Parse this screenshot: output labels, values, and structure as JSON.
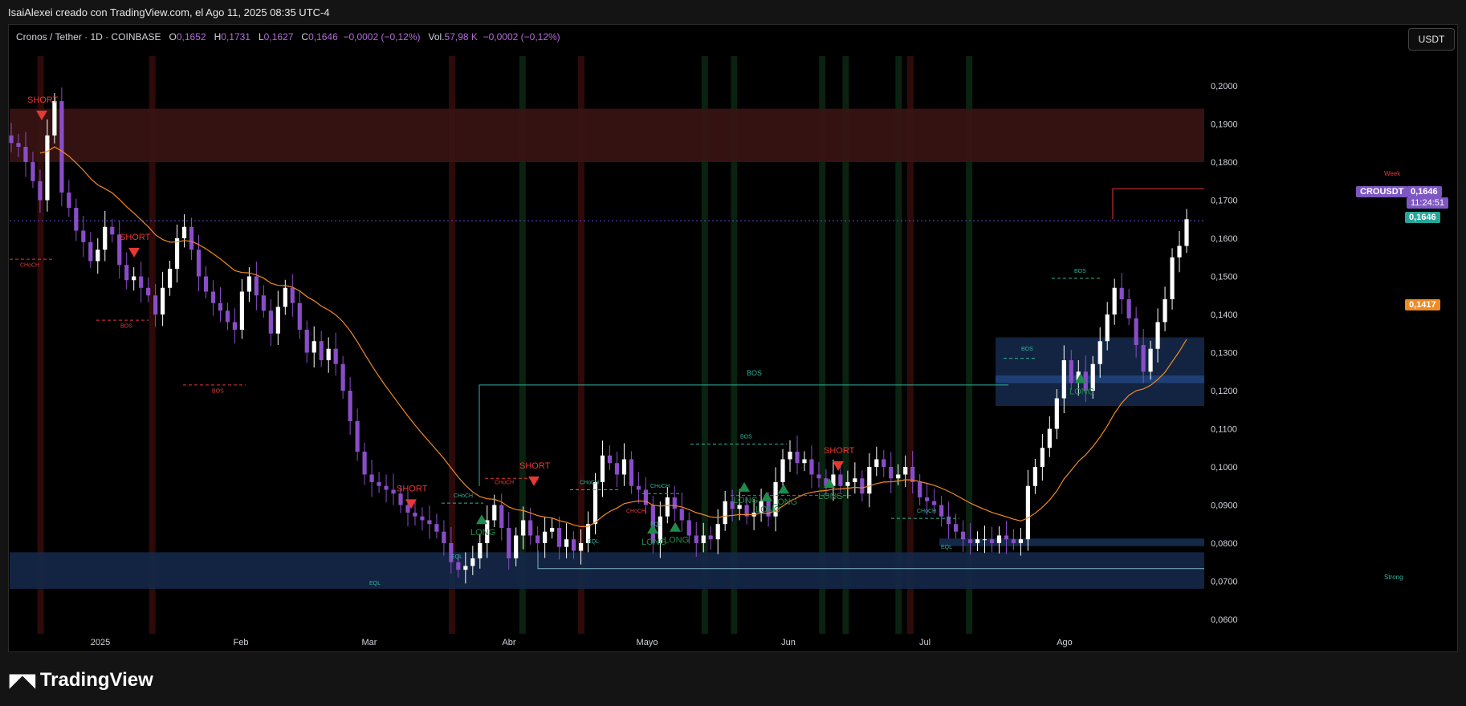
{
  "header": {
    "title": "IsaiAlexei creado con TradingView.com, el Ago 11, 2025 08:35 UTC-4"
  },
  "legend": {
    "symbol": "Cronos / Tether · 1D · COINBASE",
    "o_label": "O",
    "o_value": "0,1652",
    "h_label": "H",
    "h_value": "0,1731",
    "l_label": "L",
    "l_value": "0,1627",
    "c_label": "C",
    "c_value": "0,1646",
    "change": "−0,0002 (−0,12%)",
    "vol_label": "Vol.",
    "vol_value": "57,98 K",
    "vol_change": "−0,0002 (−0,12%)"
  },
  "currency_button": "USDT",
  "price_tags": {
    "symbol_tag": "CROUSDT",
    "last_price": "0,1646",
    "countdown": "11:24:51",
    "last_price_green": "0,1646",
    "ema_price": "0,1417",
    "week_label": "Week",
    "strong_label": "Strong"
  },
  "brand": {
    "name": "TradingView",
    "logo_icon": "tradingview-logo"
  },
  "colors": {
    "up": "#ffffff",
    "down": "#8a4dc8",
    "ema": "#f08a24",
    "supply": "#3a1414",
    "demand": "#142848",
    "bos": "#2fb39c",
    "short": "#e53935",
    "long": "#1f8b4c",
    "last_purple": "#7e57c2",
    "last_green": "#26a69a"
  },
  "chart_data": {
    "type": "candlestick",
    "title": "",
    "xlabel": "",
    "ylabel": "",
    "ylim": [
      0.0562,
      0.2078
    ],
    "y_ticks": [
      "0,2000",
      "0,1900",
      "0,1800",
      "0,1700",
      "0,1600",
      "0,1500",
      "0,1400",
      "0,1300",
      "0,1200",
      "0,1100",
      "0,1000",
      "0,0900",
      "0,0800",
      "0,0700",
      "0,0600"
    ],
    "x_ticks": [
      "2025",
      "Feb",
      "Mar",
      "Abr",
      "Mayo",
      "Jun",
      "Jul",
      "Ago"
    ],
    "grid": false,
    "series": [
      {
        "name": "",
        "closes": [
          0.185,
          0.184,
          0.18,
          0.175,
          0.17,
          0.187,
          0.196,
          0.172,
          0.168,
          0.162,
          0.159,
          0.154,
          0.157,
          0.163,
          0.161,
          0.153,
          0.149,
          0.15,
          0.147,
          0.145,
          0.14,
          0.147,
          0.152,
          0.16,
          0.163,
          0.157,
          0.15,
          0.146,
          0.143,
          0.141,
          0.138,
          0.136,
          0.146,
          0.15,
          0.145,
          0.141,
          0.135,
          0.142,
          0.147,
          0.143,
          0.136,
          0.13,
          0.133,
          0.128,
          0.131,
          0.127,
          0.12,
          0.112,
          0.104,
          0.098,
          0.096,
          0.095,
          0.094,
          0.093,
          0.09,
          0.088,
          0.087,
          0.086,
          0.085,
          0.083,
          0.08,
          0.075,
          0.073,
          0.074,
          0.076,
          0.08,
          0.086,
          0.09,
          0.084,
          0.076,
          0.082,
          0.086,
          0.082,
          0.08,
          0.083,
          0.084,
          0.079,
          0.081,
          0.078,
          0.08,
          0.085,
          0.096,
          0.103,
          0.101,
          0.098,
          0.102,
          0.095,
          0.094,
          0.09,
          0.08,
          0.087,
          0.092,
          0.089,
          0.086,
          0.082,
          0.08,
          0.082,
          0.081,
          0.085,
          0.091,
          0.089,
          0.09,
          0.087,
          0.088,
          0.091,
          0.087,
          0.096,
          0.102,
          0.104,
          0.101,
          0.102,
          0.098,
          0.097,
          0.095,
          0.098,
          0.095,
          0.096,
          0.097,
          0.093,
          0.1,
          0.102,
          0.1,
          0.097,
          0.098,
          0.1,
          0.096,
          0.092,
          0.091,
          0.09,
          0.087,
          0.085,
          0.083,
          0.081,
          0.08,
          0.081,
          0.081,
          0.08,
          0.082,
          0.081,
          0.08,
          0.081,
          0.095,
          0.1,
          0.105,
          0.11,
          0.118,
          0.128,
          0.122,
          0.125,
          0.12,
          0.127,
          0.133,
          0.14,
          0.147,
          0.144,
          0.139,
          0.132,
          0.125,
          0.131,
          0.138,
          0.144,
          0.155,
          0.158,
          0.165
        ]
      }
    ],
    "ema_label": "EMA",
    "zones": {
      "supply": [
        0.18,
        0.194
      ],
      "demand_low": [
        0.068,
        0.0776
      ],
      "demand_high": [
        0.116,
        0.134
      ],
      "demand_mid": [
        0.0792,
        0.0812
      ]
    },
    "signals": [
      {
        "label": "SHORT"
      },
      {
        "label": "SHORT"
      },
      {
        "label": "SHORT"
      },
      {
        "label": "SHORT"
      },
      {
        "label": "SHORT"
      },
      {
        "label": "LONG"
      },
      {
        "label": "LONG"
      },
      {
        "label": "LONG"
      },
      {
        "label": "LONG"
      },
      {
        "label": "LONG"
      },
      {
        "label": "LONG"
      },
      {
        "label": "LONG"
      },
      {
        "label": "LONG"
      }
    ],
    "structure_labels": [
      "BOS",
      "BOS",
      "BOS",
      "BOS",
      "BOS",
      "BOS",
      "CHoCH",
      "CHoCH",
      "CHoCH",
      "CHoCH",
      "CHoCH",
      "CHoCH",
      "CHoCH",
      "EQL",
      "EQL",
      "EQL",
      "EQL",
      "EQL"
    ]
  }
}
